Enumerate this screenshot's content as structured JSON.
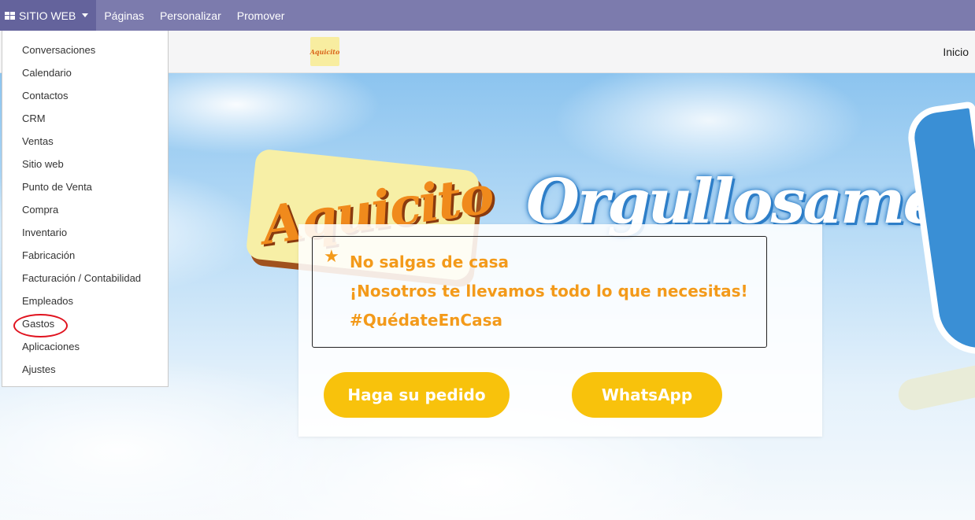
{
  "topbar": {
    "apps_label": "SITIO WEB",
    "links": [
      "Páginas",
      "Personalizar",
      "Promover"
    ]
  },
  "apps_menu": {
    "items": [
      "Conversaciones",
      "Calendario",
      "Contactos",
      "CRM",
      "Ventas",
      "Sitio web",
      "Punto de Venta",
      "Compra",
      "Inventario",
      "Fabricación",
      "Facturación / Contabilidad",
      "Empleados",
      "Gastos",
      "Aplicaciones",
      "Ajustes"
    ],
    "highlighted_item": "Gastos",
    "highlight_color": "#e0121e"
  },
  "site_header": {
    "logo_text": "Aquicito",
    "nav_home": "Inicio"
  },
  "hero": {
    "brand_text": "Aquicito",
    "slogan_text": "Orgullosamente",
    "message_lines": [
      "No salgas de casa",
      "¡Nosotros te llevamos todo lo que necesitas!",
      "#QuédateEnCasa"
    ],
    "order_button": "Haga su pedido",
    "whatsapp_button": "WhatsApp",
    "accent_color": "#f39a1a",
    "button_color": "#f8c20c"
  },
  "colors": {
    "topbar": "#7c7bad",
    "topbar_active": "#64639c"
  },
  "icons": {
    "apps": "grid-icon",
    "dropdown": "caret-down-icon",
    "message": "star-icon"
  }
}
